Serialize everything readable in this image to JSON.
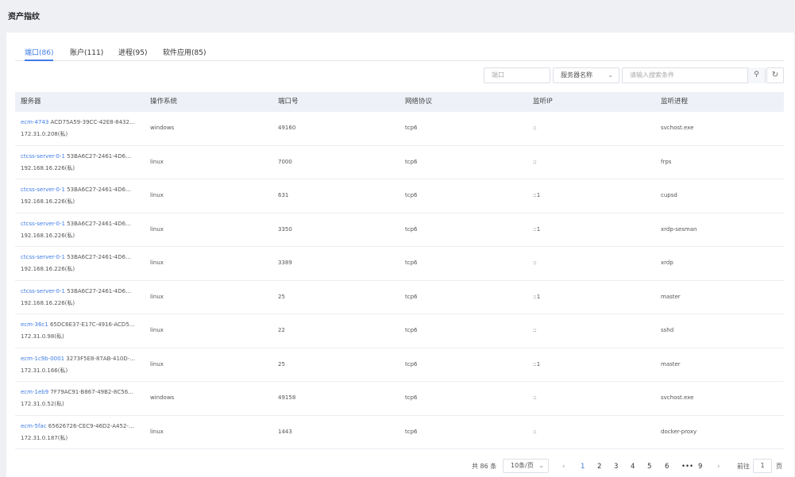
{
  "page": {
    "title": "资产指纹"
  },
  "tabs": [
    {
      "label": "端口(86)",
      "active": true
    },
    {
      "label": "账户(111)",
      "active": false
    },
    {
      "label": "进程(95)",
      "active": false
    },
    {
      "label": "软件应用(85)",
      "active": false
    }
  ],
  "filters": {
    "port_placeholder": "端口",
    "field_select": "服务器名称",
    "search_placeholder": "请输入搜索条件",
    "search_icon": "search-icon",
    "refresh_icon": "refresh-icon"
  },
  "table": {
    "headers": [
      "服务器",
      "操作系统",
      "端口号",
      "网络协议",
      "监听IP",
      "监听进程"
    ],
    "rows": [
      {
        "server_name": "ecm-4743",
        "server_id": "ACD75A59-39CC-42E8-8432…",
        "server_ip": "172.31.0.208(私)",
        "os": "windows",
        "port": "49160",
        "protocol": "tcp6",
        "listen_ip": "::",
        "process": "svchost.exe"
      },
      {
        "server_name": "ctcss-server-0-1",
        "server_id": "53BA6C27-2461-4D6…",
        "server_ip": "192.168.16.226(私)",
        "os": "linux",
        "port": "7000",
        "protocol": "tcp6",
        "listen_ip": "::",
        "process": "frps"
      },
      {
        "server_name": "ctcss-server-0-1",
        "server_id": "53BA6C27-2461-4D6…",
        "server_ip": "192.168.16.226(私)",
        "os": "linux",
        "port": "631",
        "protocol": "tcp6",
        "listen_ip": "::1",
        "process": "cupsd"
      },
      {
        "server_name": "ctcss-server-0-1",
        "server_id": "53BA6C27-2461-4D6…",
        "server_ip": "192.168.16.226(私)",
        "os": "linux",
        "port": "3350",
        "protocol": "tcp6",
        "listen_ip": "::1",
        "process": "xrdp-sesman"
      },
      {
        "server_name": "ctcss-server-0-1",
        "server_id": "53BA6C27-2461-4D6…",
        "server_ip": "192.168.16.226(私)",
        "os": "linux",
        "port": "3389",
        "protocol": "tcp6",
        "listen_ip": "::",
        "process": "xrdp"
      },
      {
        "server_name": "ctcss-server-0-1",
        "server_id": "53BA6C27-2461-4D6…",
        "server_ip": "192.168.16.226(私)",
        "os": "linux",
        "port": "25",
        "protocol": "tcp6",
        "listen_ip": "::1",
        "process": "master"
      },
      {
        "server_name": "ecm-36c1",
        "server_id": "65DC6E37-E17C-4916-ACD5…",
        "server_ip": "172.31.0.98(私)",
        "os": "linux",
        "port": "22",
        "protocol": "tcp6",
        "listen_ip": "::",
        "process": "sshd"
      },
      {
        "server_name": "ecm-1c9b-0001",
        "server_id": "3273F5E8-87AB-410D-…",
        "server_ip": "172.31.0.166(私)",
        "os": "linux",
        "port": "25",
        "protocol": "tcp6",
        "listen_ip": "::1",
        "process": "master"
      },
      {
        "server_name": "ecm-1eb9",
        "server_id": "7F79AC91-B867-49B2-8C56…",
        "server_ip": "172.31.0.52(私)",
        "os": "windows",
        "port": "49158",
        "protocol": "tcp6",
        "listen_ip": "::",
        "process": "svchost.exe"
      },
      {
        "server_name": "ecm-5fac",
        "server_id": "65626726-CEC9-46D2-A452-…",
        "server_ip": "172.31.0.187(私)",
        "os": "linux",
        "port": "1443",
        "protocol": "tcp6",
        "listen_ip": "::",
        "process": "docker-proxy"
      }
    ]
  },
  "pagination": {
    "total_label": "共 86 条",
    "page_size": "10条/页",
    "prev_icon": "chevron-left-icon",
    "next_icon": "chevron-right-icon",
    "pages": [
      "1",
      "2",
      "3",
      "4",
      "5",
      "6",
      "•••",
      "9"
    ],
    "current_page": "1",
    "goto_label": "前往",
    "goto_value": "1",
    "page_unit": "页"
  },
  "colors": {
    "accent": "#3f7ce6",
    "header_bg": "#eef2f8",
    "page_bg": "#eef0f4"
  }
}
